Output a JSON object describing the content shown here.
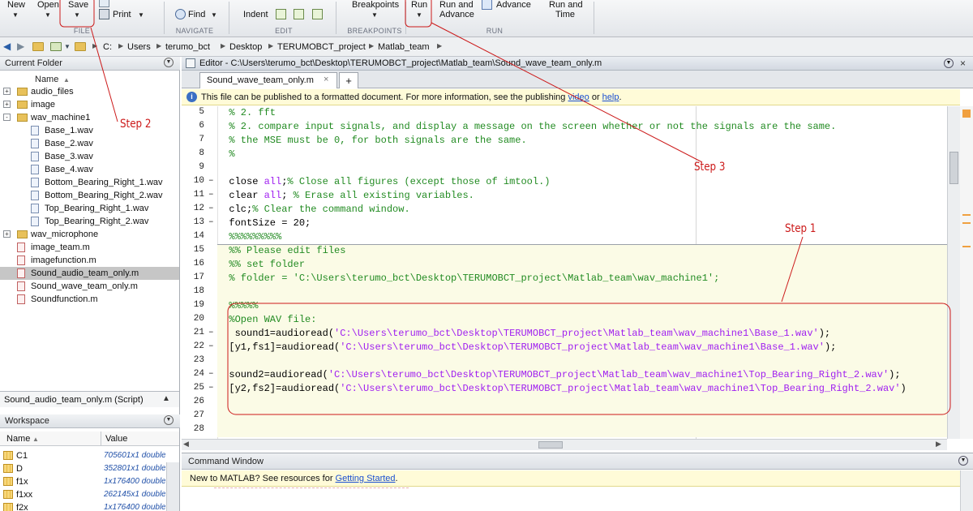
{
  "toolstrip": {
    "buttons": {
      "new": "New",
      "open": "Open",
      "save": "Save",
      "print": "Print",
      "find": "Find",
      "indent": "Indent",
      "breakpoints": "Breakpoints",
      "run": "Run",
      "run_and_advance_1": "Run and",
      "run_and_advance_2": "Advance",
      "advance": "Advance",
      "run_and_time_1": "Run and",
      "run_and_time_2": "Time"
    },
    "sections": {
      "file": "FILE",
      "navigate": "NAVIGATE",
      "edit": "EDIT",
      "breakpoints": "BREAKPOINTS",
      "run": "RUN"
    }
  },
  "address_bar": {
    "crumbs": [
      "C:",
      "Users",
      "terumo_bct",
      "Desktop",
      "TERUMOBCT_project",
      "Matlab_team"
    ]
  },
  "current_folder": {
    "title": "Current Folder",
    "column_name": "Name",
    "items": [
      {
        "label": "audio_files",
        "type": "folder",
        "level": 0,
        "expander": "+"
      },
      {
        "label": "image",
        "type": "folder",
        "level": 0,
        "expander": "+"
      },
      {
        "label": "wav_machine1",
        "type": "folder",
        "level": 0,
        "expander": "-"
      },
      {
        "label": "Base_1.wav",
        "type": "wav",
        "level": 1
      },
      {
        "label": "Base_2.wav",
        "type": "wav",
        "level": 1
      },
      {
        "label": "Base_3.wav",
        "type": "wav",
        "level": 1
      },
      {
        "label": "Base_4.wav",
        "type": "wav",
        "level": 1
      },
      {
        "label": "Bottom_Bearing_Right_1.wav",
        "type": "wav",
        "level": 1
      },
      {
        "label": "Bottom_Bearing_Right_2.wav",
        "type": "wav",
        "level": 1
      },
      {
        "label": "Top_Bearing_Right_1.wav",
        "type": "wav",
        "level": 1
      },
      {
        "label": "Top_Bearing_Right_2.wav",
        "type": "wav",
        "level": 1
      },
      {
        "label": "wav_microphone",
        "type": "folder",
        "level": 0,
        "expander": "+"
      },
      {
        "label": "image_team.m",
        "type": "m",
        "level": 0
      },
      {
        "label": "imagefunction.m",
        "type": "m",
        "level": 0
      },
      {
        "label": "Sound_audio_team_only.m",
        "type": "m",
        "level": 0,
        "selected": true
      },
      {
        "label": "Sound_wave_team_only.m",
        "type": "m",
        "level": 0
      },
      {
        "label": "Soundfunction.m",
        "type": "m",
        "level": 0
      }
    ],
    "details": "Sound_audio_team_only.m  (Script)"
  },
  "workspace": {
    "title": "Workspace",
    "col_name": "Name",
    "col_value": "Value",
    "vars": [
      {
        "name": "C1",
        "value": "705601x1 double"
      },
      {
        "name": "D",
        "value": "352801x1 double"
      },
      {
        "name": "f1x",
        "value": "1x176400 double"
      },
      {
        "name": "f1xx",
        "value": "262145x1 double"
      },
      {
        "name": "f2x",
        "value": "1x176400 double"
      }
    ]
  },
  "editor": {
    "title": "Editor - C:\\Users\\terumo_bct\\Desktop\\TERUMOBCT_project\\Matlab_team\\Sound_wave_team_only.m",
    "tab_label": "Sound_wave_team_only.m",
    "tab_close": "×",
    "tab_add": "+",
    "info": {
      "text_before": "This file can be published to a formatted document. For more information, see the publishing ",
      "link_video": "video",
      "text_mid": " or ",
      "link_help": "help",
      "text_after": "."
    },
    "lines": [
      {
        "n": "5",
        "dash": false,
        "cell": false,
        "parts": [
          {
            "t": "  % 2. fft",
            "c": "cm"
          }
        ]
      },
      {
        "n": "6",
        "dash": false,
        "cell": false,
        "parts": [
          {
            "t": "  % 2. compare input signals, and display a message on the screen whether or not the signals are the same.",
            "c": "cm"
          }
        ]
      },
      {
        "n": "7",
        "dash": false,
        "cell": false,
        "parts": [
          {
            "t": "  % the MSE must be 0, for both signals are the same.",
            "c": "cm"
          }
        ]
      },
      {
        "n": "8",
        "dash": false,
        "cell": false,
        "parts": [
          {
            "t": "  %",
            "c": "cm"
          }
        ]
      },
      {
        "n": "9",
        "dash": false,
        "cell": false,
        "parts": []
      },
      {
        "n": "10",
        "dash": true,
        "cell": false,
        "parts": [
          {
            "t": "  close ",
            "c": ""
          },
          {
            "t": "all",
            "c": "str"
          },
          {
            "t": ";",
            "c": ""
          },
          {
            "t": "% Close all figures (except those of imtool.)",
            "c": "cm"
          }
        ]
      },
      {
        "n": "11",
        "dash": true,
        "cell": false,
        "parts": [
          {
            "t": "  clear ",
            "c": ""
          },
          {
            "t": "all",
            "c": "str"
          },
          {
            "t": "; ",
            "c": ""
          },
          {
            "t": "% Erase all existing variables.",
            "c": "cm"
          }
        ]
      },
      {
        "n": "12",
        "dash": true,
        "cell": false,
        "parts": [
          {
            "t": "  clc;",
            "c": ""
          },
          {
            "t": "% Clear the command window.",
            "c": "cm"
          }
        ]
      },
      {
        "n": "13",
        "dash": true,
        "cell": false,
        "parts": [
          {
            "t": "  fontSize = 20;",
            "c": ""
          }
        ]
      },
      {
        "n": "14",
        "dash": false,
        "cell": false,
        "parts": [
          {
            "t": "  %%%%%%%%%",
            "c": "cm"
          }
        ]
      },
      {
        "n": "15",
        "dash": false,
        "cell": true,
        "parts": [
          {
            "t": "  %% Please edit files",
            "c": "cm"
          }
        ]
      },
      {
        "n": "16",
        "dash": false,
        "cell": true,
        "parts": [
          {
            "t": "  %% set folder",
            "c": "cm"
          }
        ]
      },
      {
        "n": "17",
        "dash": false,
        "cell": true,
        "parts": [
          {
            "t": "  % folder = 'C:\\Users\\terumo_bct\\Desktop\\TERUMOBCT_project\\Matlab_team\\wav_machine1';",
            "c": "cm"
          }
        ]
      },
      {
        "n": "18",
        "dash": false,
        "cell": true,
        "parts": []
      },
      {
        "n": "19",
        "dash": false,
        "cell": true,
        "parts": [
          {
            "t": "  %%%%%",
            "c": "cm"
          }
        ]
      },
      {
        "n": "20",
        "dash": false,
        "cell": true,
        "parts": [
          {
            "t": "  %Open WAV file:",
            "c": "cm"
          }
        ]
      },
      {
        "n": "21",
        "dash": true,
        "cell": true,
        "parts": [
          {
            "t": "   sound1=audioread(",
            "c": ""
          },
          {
            "t": "'C:\\Users\\terumo_bct\\Desktop\\TERUMOBCT_project\\Matlab_team\\wav_machine1\\Base_1.wav'",
            "c": "str"
          },
          {
            "t": ");",
            "c": ""
          }
        ]
      },
      {
        "n": "22",
        "dash": true,
        "cell": true,
        "parts": [
          {
            "t": "  [y1,fs1]=audioread(",
            "c": ""
          },
          {
            "t": "'C:\\Users\\terumo_bct\\Desktop\\TERUMOBCT_project\\Matlab_team\\wav_machine1\\Base_1.wav'",
            "c": "str"
          },
          {
            "t": ");",
            "c": ""
          }
        ]
      },
      {
        "n": "23",
        "dash": false,
        "cell": true,
        "parts": []
      },
      {
        "n": "24",
        "dash": true,
        "cell": true,
        "parts": [
          {
            "t": "  sound2=audioread(",
            "c": ""
          },
          {
            "t": "'C:\\Users\\terumo_bct\\Desktop\\TERUMOBCT_project\\Matlab_team\\wav_machine1\\Top_Bearing_Right_2.wav'",
            "c": "str"
          },
          {
            "t": ");",
            "c": ""
          }
        ]
      },
      {
        "n": "25",
        "dash": true,
        "cell": true,
        "parts": [
          {
            "t": "  [y2,fs2]=audioread(",
            "c": ""
          },
          {
            "t": "'C:\\Users\\terumo_bct\\Desktop\\TERUMOBCT_project\\Matlab_team\\wav_machine1\\Top_Bearing_Right_2.wav'",
            "c": "str"
          },
          {
            "t": ")",
            "c": ""
          }
        ]
      },
      {
        "n": "26",
        "dash": false,
        "cell": true,
        "parts": []
      },
      {
        "n": "27",
        "dash": false,
        "cell": true,
        "parts": []
      },
      {
        "n": "28",
        "dash": false,
        "cell": true,
        "parts": []
      }
    ]
  },
  "command_window": {
    "title": "Command Window",
    "notice_before": "New to MATLAB? See resources for ",
    "notice_link": "Getting Started",
    "notice_after": "."
  },
  "annotations": {
    "step1": "Step 1",
    "step2": "Step 2",
    "step3": "Step 3",
    "color": "#cc1a1a"
  },
  "colors": {
    "comment": "#228b22",
    "string": "#a020f0",
    "link": "#1a4fd0",
    "info_bg": "#fffbd8",
    "cell_bg": "#fbfbe6",
    "selected_row": "#c6c6c6"
  }
}
